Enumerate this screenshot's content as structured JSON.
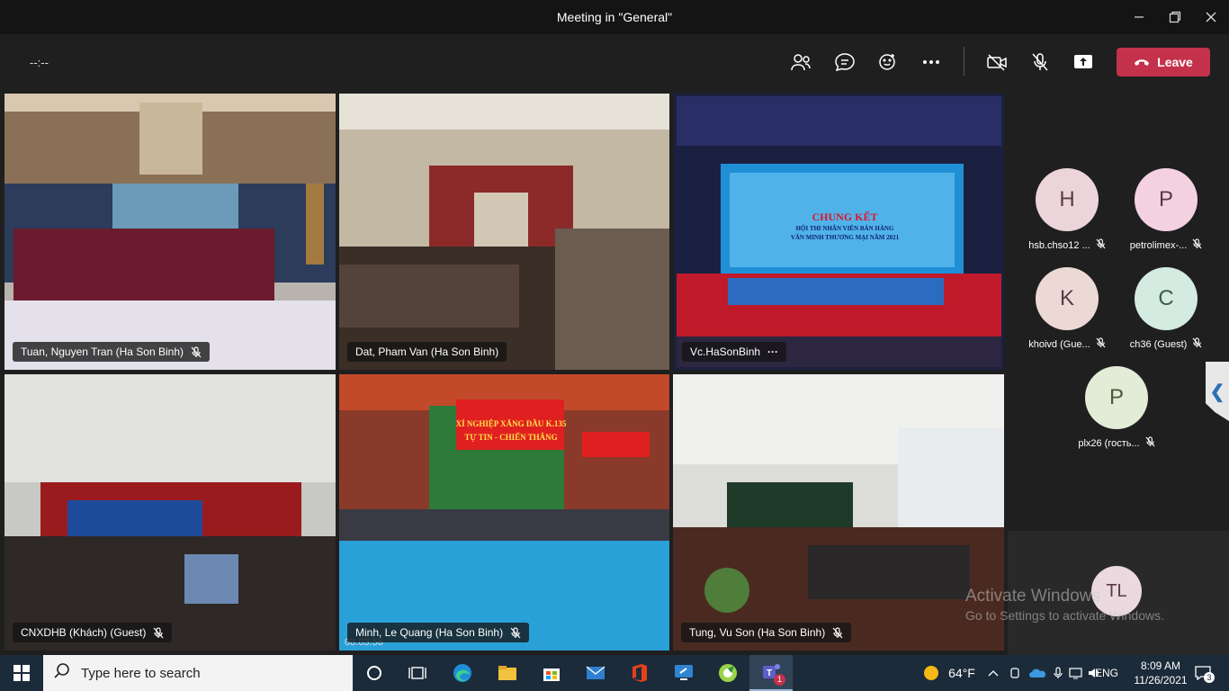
{
  "window": {
    "title": "Meeting in \"General\""
  },
  "toolbar": {
    "timer": "--:--",
    "leave_label": "Leave"
  },
  "tiles": [
    {
      "name": "Tuan, Nguyen Tran (Ha Son Binh)"
    },
    {
      "name": "Dat, Pham Van (Ha Son Binh)"
    },
    {
      "name": "Vc.HaSonBinh",
      "more": "···"
    },
    {
      "name": "CNXDHB (Khách) (Guest)"
    },
    {
      "name": "Minh, Le Quang (Ha Son Binh)",
      "timestamp": "08.03.56"
    },
    {
      "name": "Tung, Vu Son (Ha Son Binh)"
    }
  ],
  "stage_text": {
    "headline": "CHUNG KẾT",
    "line1": "HỘI THI NHÂN VIÊN BÁN HÀNG",
    "line2": "VĂN MINH THƯƠNG MẠI NĂM 2021"
  },
  "banner_text": {
    "line1": "XÍ NGHIỆP XĂNG DẦU K.135",
    "line2": "TỰ TIN - CHIẾN THẮNG"
  },
  "participants": [
    {
      "initial": "H",
      "label": "hsb.chso12 ...",
      "color": "#ecd5da"
    },
    {
      "initial": "P",
      "label": "petrolimex-...",
      "color": "#f4d1e0"
    },
    {
      "initial": "K",
      "label": "khoivd (Gue...",
      "color": "#ecd9d5"
    },
    {
      "initial": "C",
      "label": "ch36 (Guest)",
      "color": "#d4ebe2"
    },
    {
      "initial": "P",
      "label": "plx26 (гость...",
      "color": "#e3ecd6"
    }
  ],
  "self": {
    "initials": "TL"
  },
  "watermark": {
    "line1": "Activate Windows",
    "line2": "Go to Settings to activate Windows."
  },
  "taskbar": {
    "search_placeholder": "Type here to search",
    "weather": "64°F",
    "language": "ENG",
    "time": "8:09 AM",
    "date": "11/26/2021",
    "notification_count": "3",
    "teams_badge": "1"
  },
  "colors": {
    "leave": "#c4314b",
    "active_outline": "#8b8cc7",
    "taskbar": "#1c2b3a"
  }
}
